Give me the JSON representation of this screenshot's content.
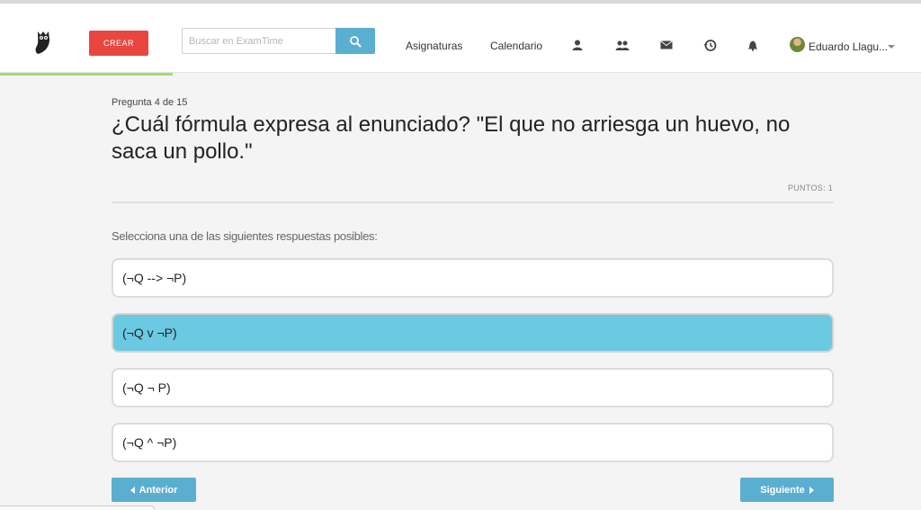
{
  "header": {
    "create_label": "CREAR",
    "search": {
      "placeholder": "Buscar en ExamTime"
    },
    "nav": {
      "subjects": "Asignaturas",
      "calendar": "Calendario"
    },
    "icons": [
      "user-icon",
      "group-icon",
      "mail-icon",
      "history-icon",
      "bell-icon"
    ],
    "user": {
      "name": "Eduardo Llagu..."
    }
  },
  "quiz": {
    "counter": "Pregunta 4 de 15",
    "question": "¿Cuál fórmula expresa al enunciado? \"El que no arriesga un huevo, no saca un pollo.\"",
    "points": "PUNTOS: 1",
    "instruction": "Selecciona una de las siguientes respuestas posibles:",
    "answers": [
      {
        "text": "(¬Q --> ¬P)",
        "selected": false
      },
      {
        "text": "(¬Q v ¬P)",
        "selected": true
      },
      {
        "text": "(¬Q ¬ P)",
        "selected": false
      },
      {
        "text": "(¬Q ^ ¬P)",
        "selected": false
      }
    ],
    "prev_label": "Anterior",
    "next_label": "Siguiente"
  },
  "colors": {
    "accent": "#5aaed0",
    "create": "#e8463f",
    "selected_answer": "#6bc9e2",
    "progress": "#a9d86e"
  }
}
